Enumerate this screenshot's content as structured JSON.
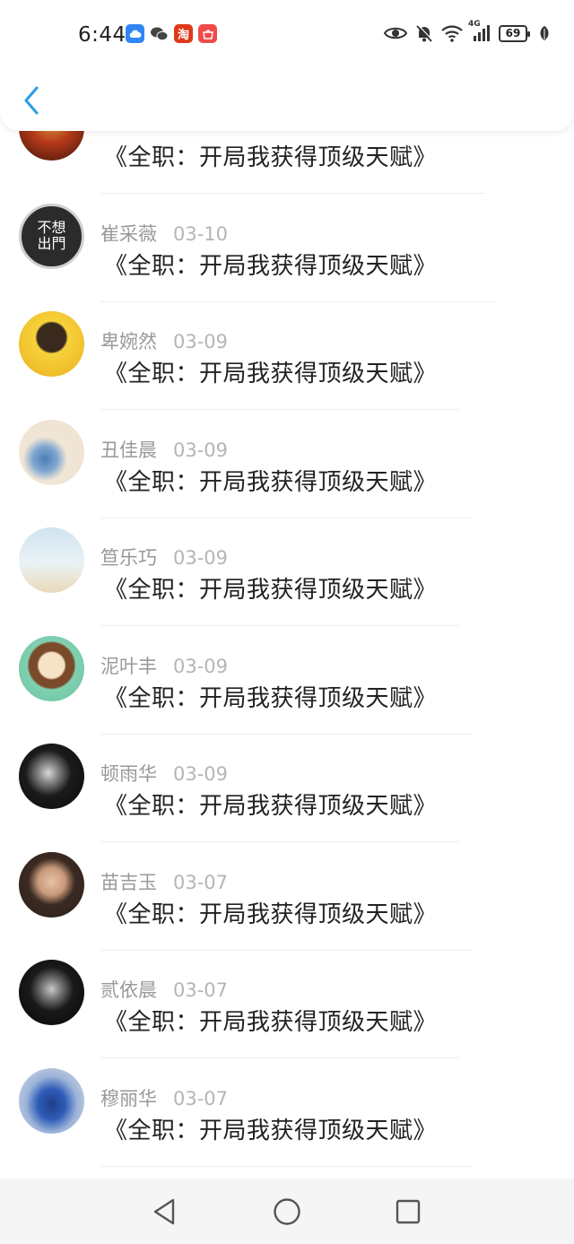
{
  "status_bar": {
    "time": "6:44",
    "app_icons": [
      "cloud-icon",
      "wechat-icon",
      "taobao-icon",
      "huawei-icon"
    ],
    "taobao_glyph": "淘",
    "battery_level": "69",
    "signal_label": "4G"
  },
  "header": {
    "back_icon": "chevron-left-icon",
    "accent_color": "#2f9be6"
  },
  "comments": [
    {
      "name": "",
      "date": "",
      "text": "《全职：开局我获得顶级天赋》"
    },
    {
      "name": "崔采薇",
      "date": "03-10",
      "text": "《全职：开局我获得顶级天赋》",
      "avatar_text": "不想\n出門"
    },
    {
      "name": "卑婉然",
      "date": "03-09",
      "text": "《全职：开局我获得顶级天赋》"
    },
    {
      "name": "丑佳晨",
      "date": "03-09",
      "text": "《全职：开局我获得顶级天赋》"
    },
    {
      "name": "笪乐巧",
      "date": "03-09",
      "text": "《全职：开局我获得顶级天赋》"
    },
    {
      "name": "泥叶丰",
      "date": "03-09",
      "text": "《全职：开局我获得顶级天赋》"
    },
    {
      "name": "顿雨华",
      "date": "03-09",
      "text": "《全职：开局我获得顶级天赋》"
    },
    {
      "name": "苗吉玉",
      "date": "03-07",
      "text": "《全职：开局我获得顶级天赋》"
    },
    {
      "name": "贰依晨",
      "date": "03-07",
      "text": "《全职：开局我获得顶级天赋》"
    },
    {
      "name": "穆丽华",
      "date": "03-07",
      "text": "《全职：开局我获得顶级天赋》"
    }
  ],
  "nav_bar": {
    "buttons": [
      "back-triangle-icon",
      "home-circle-icon",
      "recents-square-icon"
    ]
  }
}
